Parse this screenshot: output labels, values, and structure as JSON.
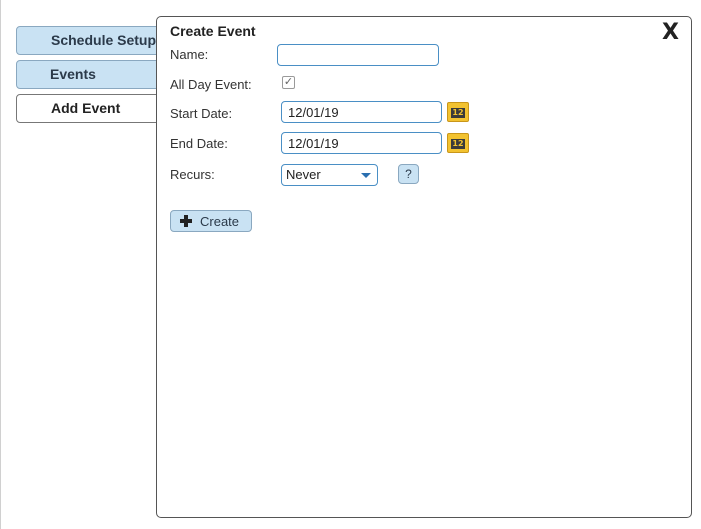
{
  "sidebar": {
    "items": [
      {
        "label": "Schedule Setup",
        "active": false
      },
      {
        "label": "Events",
        "active": false
      },
      {
        "label": "Add Event",
        "active": true
      }
    ]
  },
  "dialog": {
    "title": "Create Event",
    "close_label": "X",
    "fields": {
      "name": {
        "label": "Name:",
        "value": ""
      },
      "all_day": {
        "label": "All Day Event:",
        "checked": true,
        "mark": "✓"
      },
      "start_date": {
        "label": "Start Date:",
        "value": "12/01/19",
        "calendar_icon_text": "12"
      },
      "end_date": {
        "label": "End Date:",
        "value": "12/01/19",
        "calendar_icon_text": "12"
      },
      "recurs": {
        "label": "Recurs:",
        "selected": "Never",
        "help_label": "?"
      }
    },
    "create_button_label": "Create"
  },
  "colors": {
    "tab_background": "#c9e2f3",
    "input_border": "#4a8fc5",
    "calendar_icon": "#f2c230"
  }
}
